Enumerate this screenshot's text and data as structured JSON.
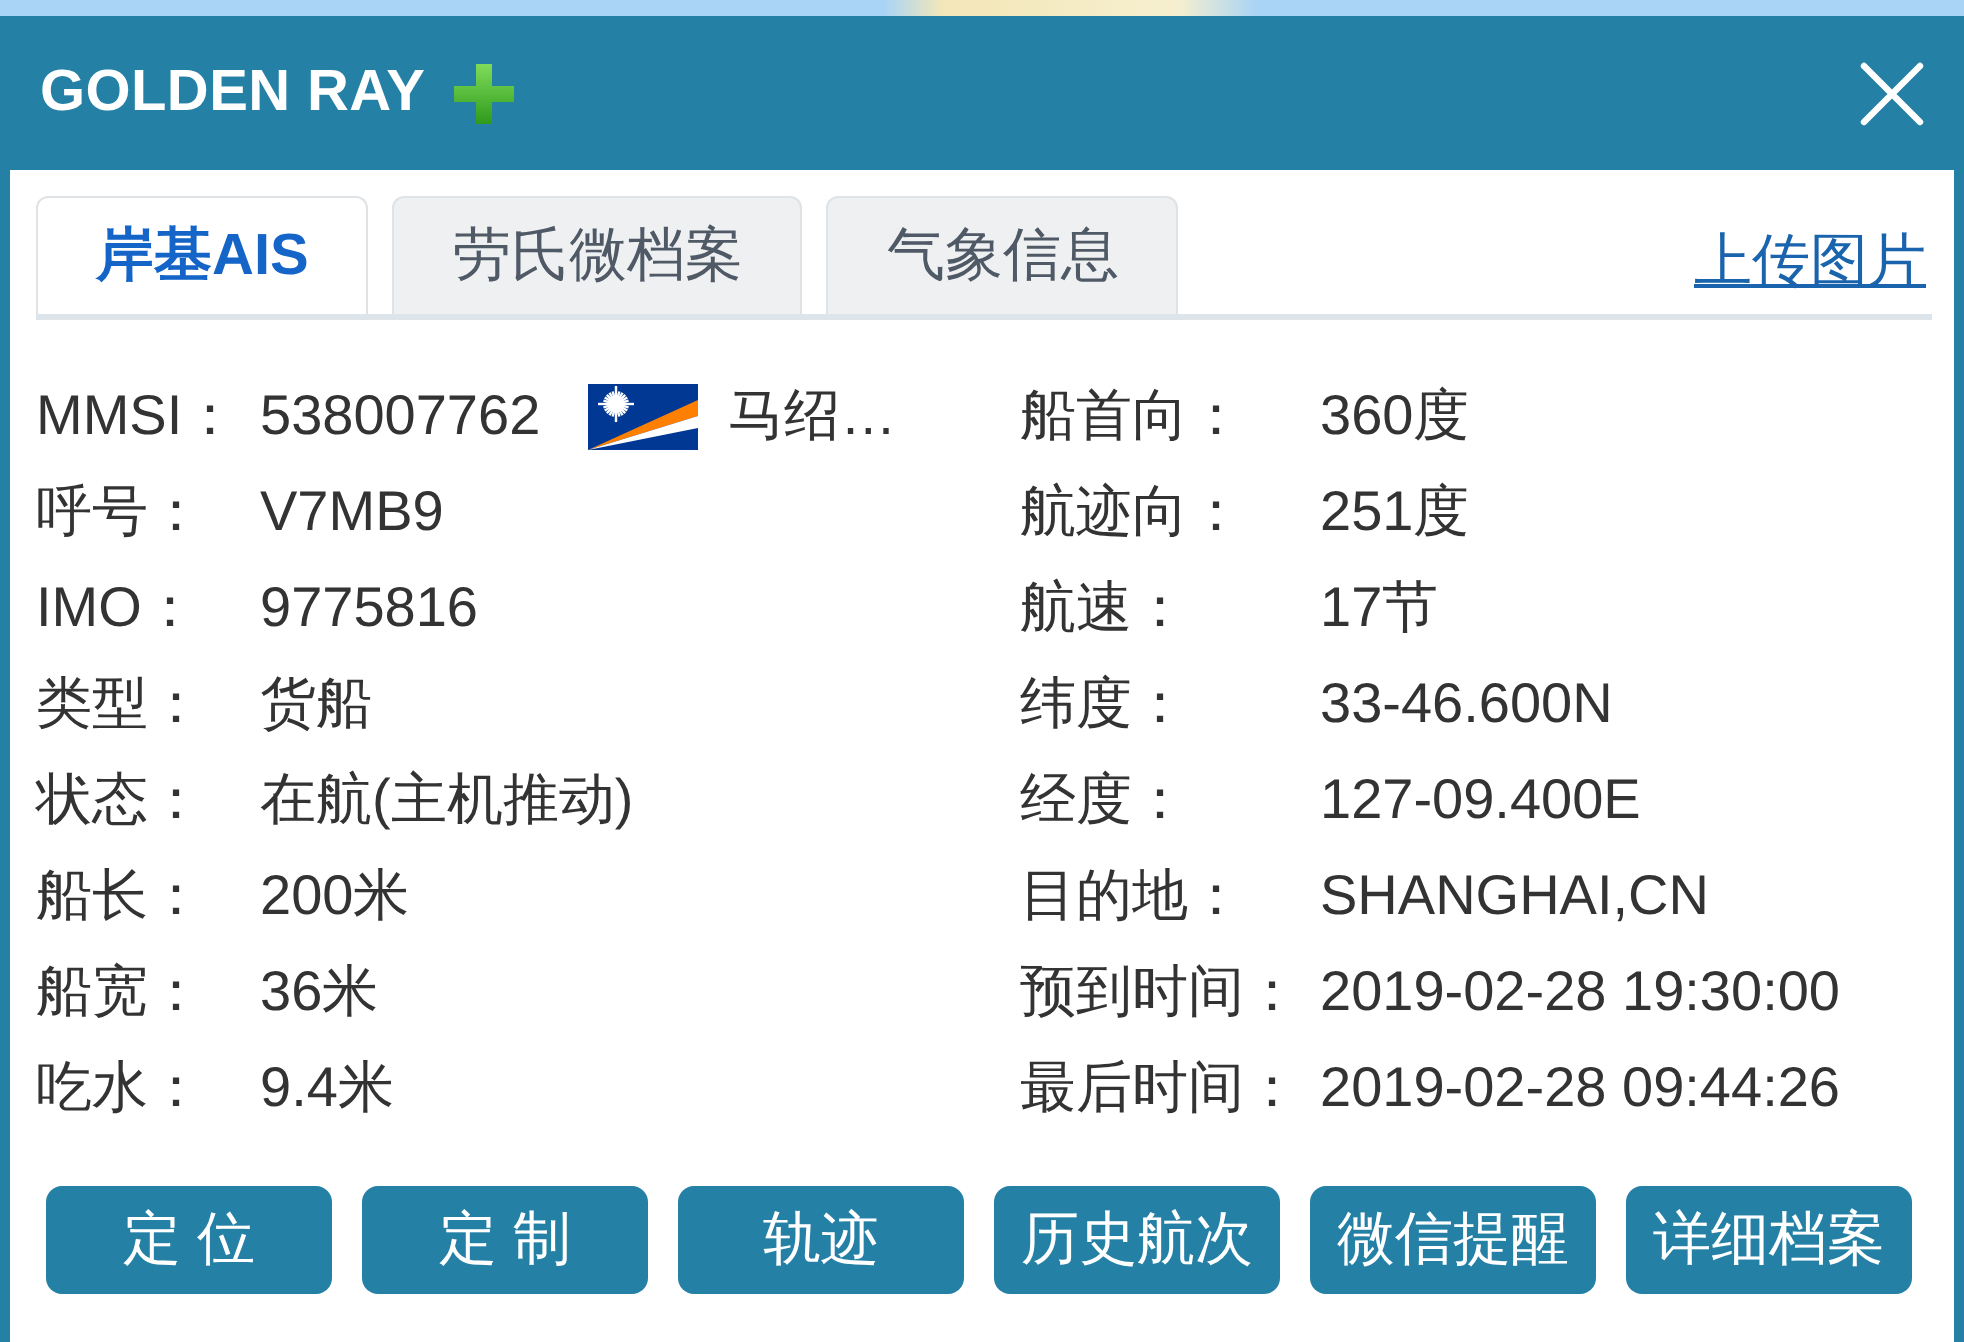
{
  "window": {
    "title": "GOLDEN RAY"
  },
  "tabs": [
    {
      "label": "岸基AIS",
      "selected": true
    },
    {
      "label": "劳氏微档案",
      "selected": false
    },
    {
      "label": "气象信息",
      "selected": false
    }
  ],
  "upload_link": "上传图片",
  "left_fields": [
    {
      "label": "MMSI：",
      "value": "538007762",
      "country": "马绍…"
    },
    {
      "label": "呼号：",
      "value": "V7MB9"
    },
    {
      "label": "IMO：",
      "value": "9775816"
    },
    {
      "label": "类型：",
      "value": "货船"
    },
    {
      "label": "状态：",
      "value": "在航(主机推动)"
    },
    {
      "label": "船长：",
      "value": "200米"
    },
    {
      "label": "船宽：",
      "value": "36米"
    },
    {
      "label": "吃水：",
      "value": "9.4米"
    }
  ],
  "right_fields": [
    {
      "label": "船首向：",
      "value": "360度"
    },
    {
      "label": "航迹向：",
      "value": "251度"
    },
    {
      "label": "航速：",
      "value": "17节"
    },
    {
      "label": "纬度：",
      "value": "33-46.600N"
    },
    {
      "label": "经度：",
      "value": "127-09.400E"
    },
    {
      "label": "目的地：",
      "value": "SHANGHAI,CN"
    },
    {
      "label": "预到时间：",
      "value": "2019-02-28 19:30:00"
    },
    {
      "label": "最后时间：",
      "value": "2019-02-28 09:44:26"
    }
  ],
  "buttons": [
    "定 位",
    "定 制",
    "轨迹",
    "历史航次",
    "微信提醒",
    "详细档案"
  ]
}
